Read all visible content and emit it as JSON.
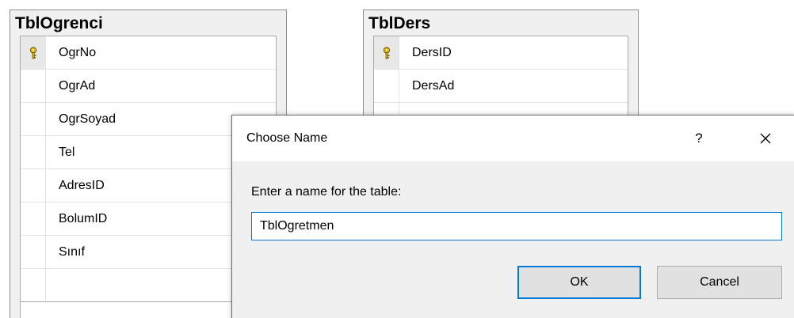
{
  "tables": [
    {
      "title": "TblOgrenci",
      "columns": [
        "OgrNo",
        "OgrAd",
        "OgrSoyad",
        "Tel",
        "AdresID",
        "BolumID",
        "Sınıf"
      ],
      "primary_key": "OgrNo",
      "key_icon": "primary-key-icon"
    },
    {
      "title": "TblDers",
      "columns": [
        "DersID",
        "DersAd"
      ],
      "primary_key": "DersID",
      "key_icon": "primary-key-icon"
    }
  ],
  "dialog": {
    "title": "Choose Name",
    "help_label": "?",
    "close_icon": "close-icon",
    "prompt": "Enter a name for the table:",
    "input_value": "TblOgretmen",
    "ok_label": "OK",
    "cancel_label": "Cancel"
  },
  "colors": {
    "accent": "#0078d7",
    "dialog_bg": "#f0f0f0",
    "key_icon": "#e5b800"
  }
}
